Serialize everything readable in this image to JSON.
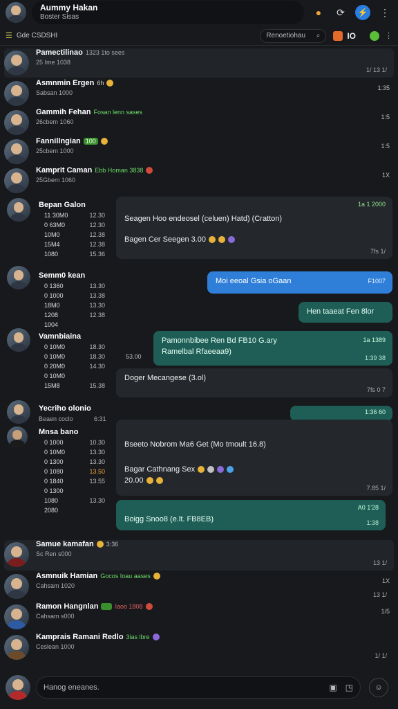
{
  "header": {
    "title": "Aummy Hakan",
    "subtitle": "Boster Sisas",
    "icons": [
      "coin-icon",
      "refresh-icon",
      "lightning-icon",
      "more-icon"
    ]
  },
  "subbar": {
    "label": "Gde CSDSHI",
    "search_placeholder": "Renoetiohau",
    "label2": "IO"
  },
  "chats": [
    {
      "name": "Pamectilinao",
      "tag": "1323 1to sees",
      "meta": "25 Ime 1038",
      "time": "",
      "acts": "1/ 13 1/"
    },
    {
      "name": "Asmnmin Ergen",
      "tag": "6h",
      "meta": "Sabsan 1000",
      "time": "1:35",
      "acts": ""
    },
    {
      "name": "Gammih Fehan",
      "tag": "Fosan lenn sases",
      "meta": "26cbem 1060",
      "time": "1:5",
      "acts": ""
    },
    {
      "name": "Fannillngian",
      "tag": "100",
      "meta": "25cbem 1000",
      "time": "1:5",
      "acts": ""
    },
    {
      "name": "Kamprit Caman",
      "tag": "Ebb Homan 3838",
      "meta": "25Gbem 1060",
      "time": "1X",
      "acts": ""
    }
  ],
  "group1": {
    "name": "Bepan Galon",
    "list": [
      {
        "n": "11  30M0",
        "v": "12.30"
      },
      {
        "n": "0  63M0",
        "v": "12.30"
      },
      {
        "n": "10M0",
        "v": "12.38"
      },
      {
        "n": "15M4",
        "v": "12.38"
      },
      {
        "n": "1080",
        "v": "15.36"
      }
    ],
    "bubble_time": "1a 1 2000",
    "bubble_line1": "Seagen Hoo endeosel (celuen)  Hatd) (Cratton)",
    "bubble_line2": "Bagen Cer Seegen  3.00",
    "bubble_foot": "7fs 1/"
  },
  "group2": {
    "name": "Semm0 kean",
    "list": [
      {
        "n": "0  1360",
        "v": "13.30"
      },
      {
        "n": "0  1000",
        "v": "13.38"
      },
      {
        "n": "18M0",
        "v": "13.30"
      },
      {
        "n": "1208",
        "v": "12.38"
      },
      {
        "n": "1004",
        "v": ""
      }
    ],
    "blue_text": "Moi eeoal Gsia oGaan",
    "blue_time": "F1007",
    "teal_text": "Hen taaeat Fen 8lor"
  },
  "group3": {
    "name": "Vamnbiaina",
    "list": [
      {
        "n": "0  10M0",
        "v": "18.30"
      },
      {
        "n": "0  10M0",
        "v": "18.30"
      },
      {
        "n": "0  20M0",
        "v": "14.30"
      },
      {
        "n": "0  10M0",
        "v": ""
      },
      {
        "n": "15M8",
        "v": "15.38"
      }
    ],
    "side": "53.00",
    "teal_line1": "Pamonnbibee Ren Bd FB10 G.ary",
    "teal_line2": "Ramelbal  Rfaeeaa9)",
    "teal_time": "1a 1389",
    "teal_foot": "1:39 38",
    "dark_line": "Doger Mecangese (3.ol)",
    "dark_foot": "7fs 0 7"
  },
  "group4": {
    "name": "Yecriho olonio",
    "meta": "Beaen coclo",
    "time": "6:31",
    "sub_name": "Mnsa bano",
    "list": [
      {
        "n": "0  1000",
        "v": "10.30"
      },
      {
        "n": "0  10M0",
        "v": "13.30"
      },
      {
        "n": "0  1300",
        "v": "13.30"
      },
      {
        "n": "0  1080",
        "v": "13.50"
      },
      {
        "n": "0  1840",
        "v": "13.55"
      },
      {
        "n": "0  1300",
        "v": ""
      },
      {
        "n": "1080",
        "v": "13.30"
      },
      {
        "n": "2080",
        "v": ""
      }
    ],
    "tab_text": "1:36 60",
    "dark_line1": "Bseeto Nobrom Ma6 Get (Mo tmoult 16.8)",
    "dark_line2": "Bagar Cathnang Sex",
    "dark_line3": "20.00",
    "dark_foot": "7.85  1/",
    "teal_line": "Boigg  Snoo8 (e.lt.  FB8EB)",
    "teal_time": "A0 1'28",
    "teal_foot": "1:38"
  },
  "chats_bottom": [
    {
      "name": "Samue kamafan",
      "tag": "3:36",
      "meta": "Sc Ren s000",
      "time": "",
      "acts": "13 1/"
    },
    {
      "name": "Asmnuik Hamian",
      "tag": "Gocos Ioau aases",
      "meta": "Cahsam 1020",
      "time": "1X",
      "acts": "13 1/"
    },
    {
      "name": "Ramon Hangnlan",
      "tag": "Iaoo 1808",
      "meta": "Cahsam s000",
      "time": "1/5",
      "acts": ""
    },
    {
      "name": "Kamprais Ramani Redlo",
      "tag": "3ias lbre",
      "meta": "Ceslean 1000",
      "time": "",
      "acts": "1/ 1/"
    }
  ],
  "composer": {
    "placeholder": "Hanog eneanes."
  }
}
